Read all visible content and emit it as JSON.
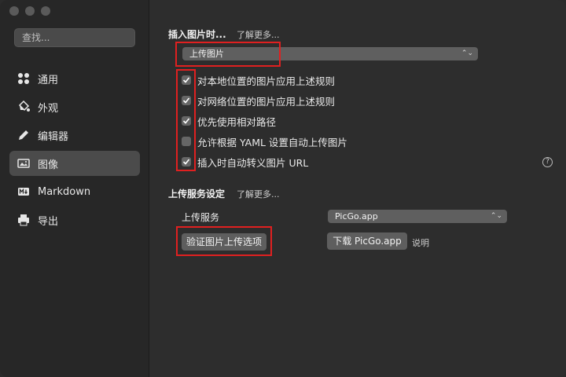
{
  "sidebar": {
    "search_placeholder": "查找...",
    "items": [
      {
        "label": "通用",
        "icon": "grid-icon"
      },
      {
        "label": "外观",
        "icon": "paint-bucket-icon"
      },
      {
        "label": "编辑器",
        "icon": "pencil-icon"
      },
      {
        "label": "图像",
        "icon": "image-icon",
        "active": true
      },
      {
        "label": "Markdown",
        "icon": "markdown-icon"
      },
      {
        "label": "导出",
        "icon": "printer-icon"
      }
    ]
  },
  "insert_image": {
    "title": "插入图片时...",
    "learn_more": "了解更多...",
    "action_select": "上传图片",
    "options": [
      {
        "label": "对本地位置的图片应用上述规则",
        "checked": true
      },
      {
        "label": "对网络位置的图片应用上述规则",
        "checked": true
      },
      {
        "label": "优先使用相对路径",
        "checked": true
      },
      {
        "label": "允许根据 YAML 设置自动上传图片",
        "checked": false
      },
      {
        "label": "插入时自动转义图片 URL",
        "checked": true
      }
    ],
    "help": "?"
  },
  "upload_service": {
    "title": "上传服务设定",
    "learn_more": "了解更多...",
    "service_label": "上传服务",
    "service_select": "PicGo.app",
    "verify_button": "验证图片上传选项",
    "download_button": "下载 PicGo.app",
    "explain_link": "说明"
  },
  "colors": {
    "highlight": "#e02020",
    "sidebar_bg": "#272727",
    "main_bg": "#2d2d2d"
  }
}
